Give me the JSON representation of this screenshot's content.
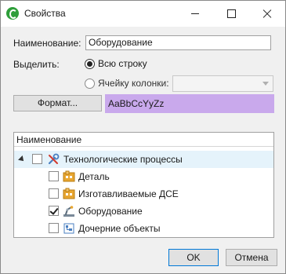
{
  "window": {
    "title": "Свойства"
  },
  "form": {
    "name_label": "Наименование:",
    "name_value": "Оборудование",
    "highlight_label": "Выделить:",
    "option_row": "Всю строку",
    "option_cell": "Ячейку колонки:",
    "option_selected": "Всю строку",
    "column_select_value": "",
    "format_button": "Формат...",
    "preview_text": "AaBbCcYyZz",
    "preview_color": "#c9a9ec"
  },
  "tree": {
    "header": "Наименование",
    "root": {
      "label": "Технологические процессы",
      "checked": false,
      "expanded": true,
      "icon": "tools-icon"
    },
    "children": [
      {
        "label": "Деталь",
        "checked": false,
        "icon": "part-icon"
      },
      {
        "label": "Изготавливаемые ДСЕ",
        "checked": false,
        "icon": "assembly-icon"
      },
      {
        "label": "Оборудование",
        "checked": true,
        "icon": "equipment-icon"
      },
      {
        "label": "Дочерние объекты",
        "checked": false,
        "icon": "child-objects-icon"
      }
    ]
  },
  "buttons": {
    "ok": "OK",
    "cancel": "Отмена"
  }
}
